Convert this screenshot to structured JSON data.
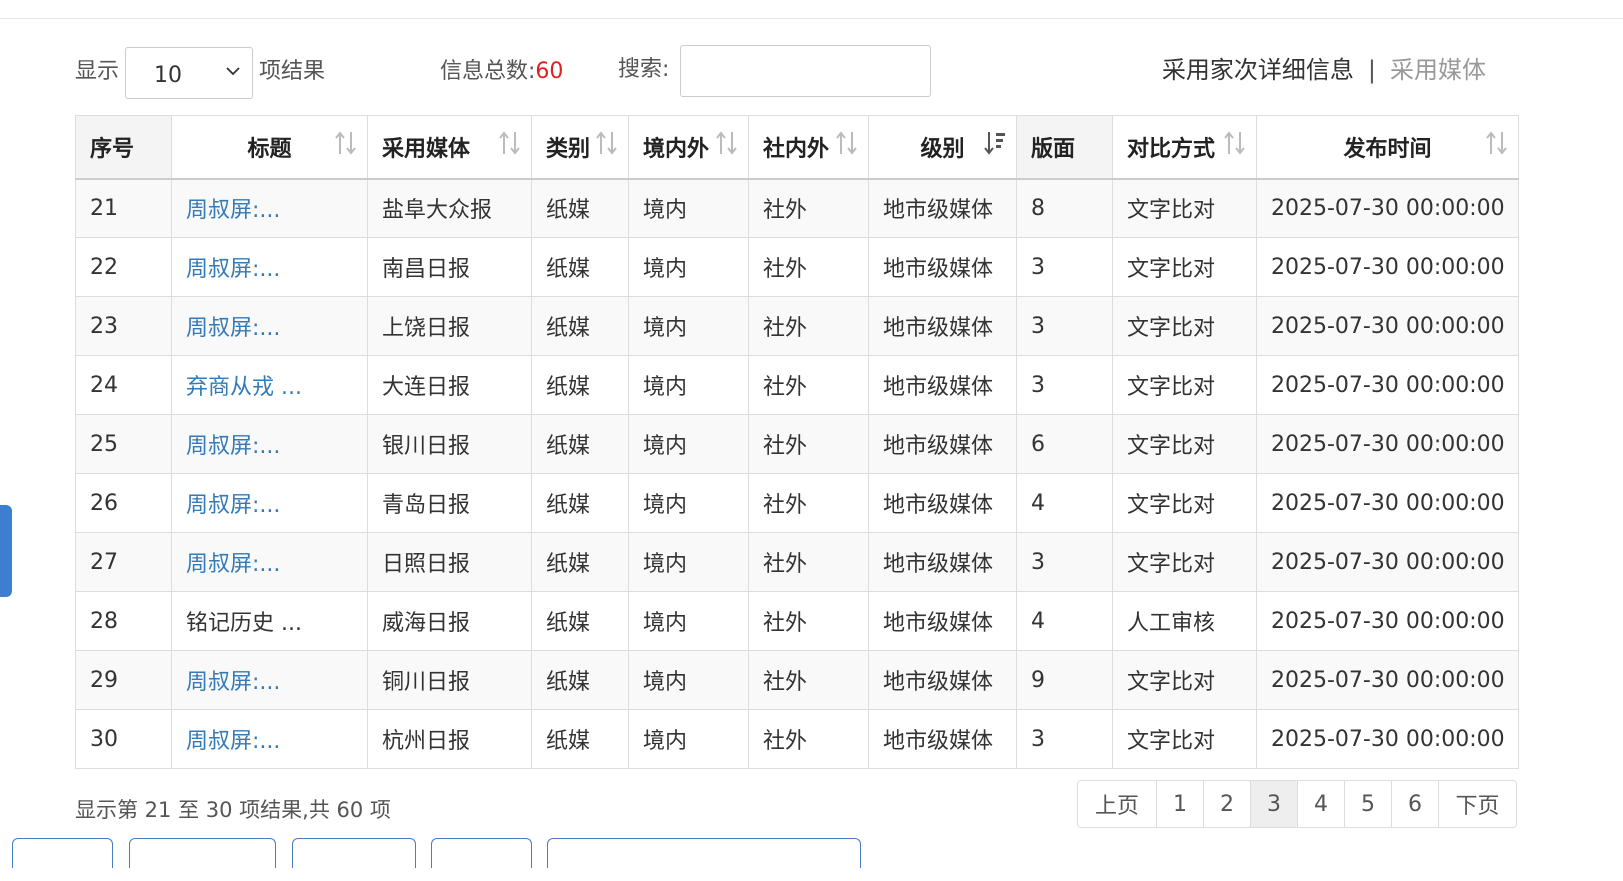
{
  "toolbar": {
    "show_label": "显示",
    "page_length": "10",
    "results_label": "项结果",
    "total_label": "信息总数:",
    "total_count": "60",
    "search_label": "搜索:",
    "search_value": "",
    "tab_detail": "采用家次详细信息",
    "tab_separator": "|",
    "tab_media": "采用媒体"
  },
  "table": {
    "headers": [
      "序号",
      "标题",
      "采用媒体",
      "类别",
      "境内外",
      "社内外",
      "级别",
      "版面",
      "对比方式",
      "发布时间"
    ],
    "rows": [
      {
        "no": "21",
        "title": "周叔屏:...",
        "media": "盐阜大众报",
        "category": "纸媒",
        "domestic": "境内",
        "internal": "社外",
        "level": "地市级媒体",
        "page": "8",
        "method": "文字比对",
        "time": "2025-07-30 00:00:00"
      },
      {
        "no": "22",
        "title": "周叔屏:...",
        "media": "南昌日报",
        "category": "纸媒",
        "domestic": "境内",
        "internal": "社外",
        "level": "地市级媒体",
        "page": "3",
        "method": "文字比对",
        "time": "2025-07-30 00:00:00"
      },
      {
        "no": "23",
        "title": "周叔屏:...",
        "media": "上饶日报",
        "category": "纸媒",
        "domestic": "境内",
        "internal": "社外",
        "level": "地市级媒体",
        "page": "3",
        "method": "文字比对",
        "time": "2025-07-30 00:00:00"
      },
      {
        "no": "24",
        "title": "弃商从戎 ...",
        "media": "大连日报",
        "category": "纸媒",
        "domestic": "境内",
        "internal": "社外",
        "level": "地市级媒体",
        "page": "3",
        "method": "文字比对",
        "time": "2025-07-30 00:00:00"
      },
      {
        "no": "25",
        "title": "周叔屏:...",
        "media": "银川日报",
        "category": "纸媒",
        "domestic": "境内",
        "internal": "社外",
        "level": "地市级媒体",
        "page": "6",
        "method": "文字比对",
        "time": "2025-07-30 00:00:00"
      },
      {
        "no": "26",
        "title": "周叔屏:...",
        "media": "青岛日报",
        "category": "纸媒",
        "domestic": "境内",
        "internal": "社外",
        "level": "地市级媒体",
        "page": "4",
        "method": "文字比对",
        "time": "2025-07-30 00:00:00"
      },
      {
        "no": "27",
        "title": "周叔屏:...",
        "media": "日照日报",
        "category": "纸媒",
        "domestic": "境内",
        "internal": "社外",
        "level": "地市级媒体",
        "page": "3",
        "method": "文字比对",
        "time": "2025-07-30 00:00:00"
      },
      {
        "no": "28",
        "title": "铭记历史 ...",
        "media": "威海日报",
        "category": "纸媒",
        "domestic": "境内",
        "internal": "社外",
        "level": "地市级媒体",
        "page": "4",
        "method": "人工审核",
        "time": "2025-07-30 00:00:00"
      },
      {
        "no": "29",
        "title": "周叔屏:...",
        "media": "铜川日报",
        "category": "纸媒",
        "domestic": "境内",
        "internal": "社外",
        "level": "地市级媒体",
        "page": "9",
        "method": "文字比对",
        "time": "2025-07-30 00:00:00"
      },
      {
        "no": "30",
        "title": "周叔屏:...",
        "media": "杭州日报",
        "category": "纸媒",
        "domestic": "境内",
        "internal": "社外",
        "level": "地市级媒体",
        "page": "3",
        "method": "文字比对",
        "time": "2025-07-30 00:00:00"
      }
    ]
  },
  "info": "显示第 21 至 30 项结果,共 60 项",
  "pagination": {
    "prev": "上页",
    "pages": [
      "1",
      "2",
      "3",
      "4",
      "5",
      "6"
    ],
    "current": "3",
    "next": "下页"
  },
  "colors": {
    "link": "#337ab7",
    "total": "#e02020",
    "accent": "#3d7fcf"
  }
}
